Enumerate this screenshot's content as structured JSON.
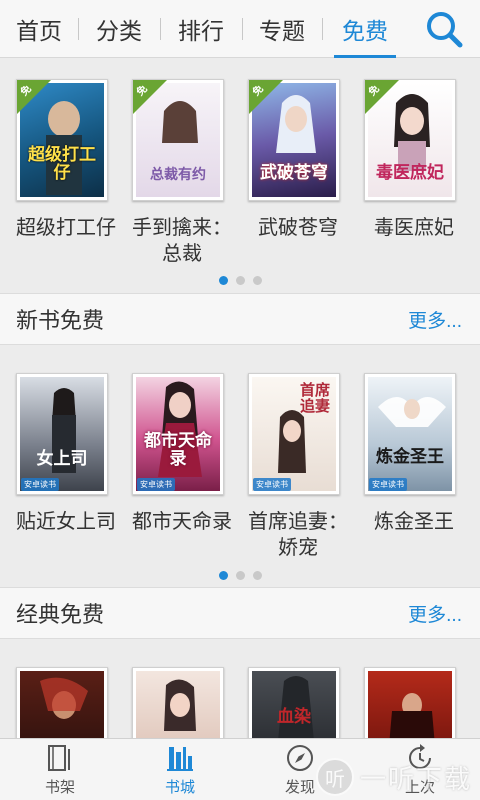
{
  "tabs": [
    {
      "label": "首页"
    },
    {
      "label": "分类"
    },
    {
      "label": "排行"
    },
    {
      "label": "专题"
    },
    {
      "label": "免费",
      "active": true
    }
  ],
  "search_icon": "search-icon",
  "carousel": {
    "badge": "免",
    "books": [
      {
        "name": "超级打工仔",
        "cover_text": "超级打工仔",
        "cover_color": "#1f6fa8"
      },
      {
        "name": "手到擒来：总裁",
        "cover_text": "总裁有约",
        "cover_color": "#e9e2ee"
      },
      {
        "name": "武破苍穹",
        "cover_text": "武破苍穹",
        "cover_color": "#5a4a8a"
      },
      {
        "name": "毒医庶妃",
        "cover_text": "毒医庶妃",
        "cover_color": "#f2eef0"
      }
    ]
  },
  "new_free": {
    "title": "新书免费",
    "more": "更多...",
    "publisher": "安卓读书",
    "books": [
      {
        "name": "贴近女上司",
        "cover_text": "女上司",
        "cover_color": "#6a6f7d"
      },
      {
        "name": "都市天命录",
        "cover_text": "都市天命录",
        "cover_color": "#b03a79"
      },
      {
        "name": "首席追妻：娇宠",
        "cover_text": "首席追妻",
        "cover_color": "#eee8e2"
      },
      {
        "name": "炼金圣王",
        "cover_text": "炼金圣王",
        "cover_color": "#c7d3dc"
      }
    ]
  },
  "classic_free": {
    "title": "经典免费",
    "more": "更多...",
    "books": [
      {
        "cover_text": "",
        "cover_color": "#3a1410"
      },
      {
        "cover_text": "",
        "cover_color": "#e8d2c9"
      },
      {
        "cover_text": "血染",
        "cover_color": "#2f3236"
      },
      {
        "cover_text": "",
        "cover_color": "#8c1a12"
      }
    ]
  },
  "bottom_nav": [
    {
      "label": "书架",
      "icon": "bookshelf-icon"
    },
    {
      "label": "书城",
      "icon": "bookstore-icon",
      "active": true
    },
    {
      "label": "发现",
      "icon": "compass-icon"
    },
    {
      "label": "上次",
      "icon": "history-icon"
    }
  ],
  "watermark": {
    "glyph": "听",
    "text": "一听下载"
  }
}
